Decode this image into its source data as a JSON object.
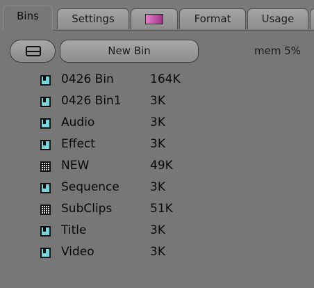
{
  "tabs": [
    {
      "label": "Bins",
      "active": true
    },
    {
      "label": "Settings",
      "active": false
    },
    {
      "label": "",
      "icon": "color-swatch-icon",
      "active": false
    },
    {
      "label": "Format",
      "active": false
    },
    {
      "label": "Usage",
      "active": false
    }
  ],
  "toolbar": {
    "menu_icon": "bin-menu-icon",
    "new_bin_label": "New Bin",
    "memory": "mem 5%"
  },
  "bins": [
    {
      "name": "0426 Bin",
      "size": "164K",
      "icon": "bin-icon"
    },
    {
      "name": "0426 Bin1",
      "size": "3K",
      "icon": "bin-icon"
    },
    {
      "name": "Audio",
      "size": "3K",
      "icon": "bin-icon"
    },
    {
      "name": "Effect",
      "size": "3K",
      "icon": "bin-icon"
    },
    {
      "name": "NEW",
      "size": "49K",
      "icon": "grid-bin-icon"
    },
    {
      "name": "Sequence",
      "size": "3K",
      "icon": "bin-icon"
    },
    {
      "name": "SubClips",
      "size": "51K",
      "icon": "grid-bin-icon"
    },
    {
      "name": "Title",
      "size": "3K",
      "icon": "bin-icon"
    },
    {
      "name": "Video",
      "size": "3K",
      "icon": "bin-icon"
    }
  ],
  "colors": {
    "background": "#777777",
    "bin_icon": "#7cd3d9",
    "swatch": "#c659ae"
  }
}
